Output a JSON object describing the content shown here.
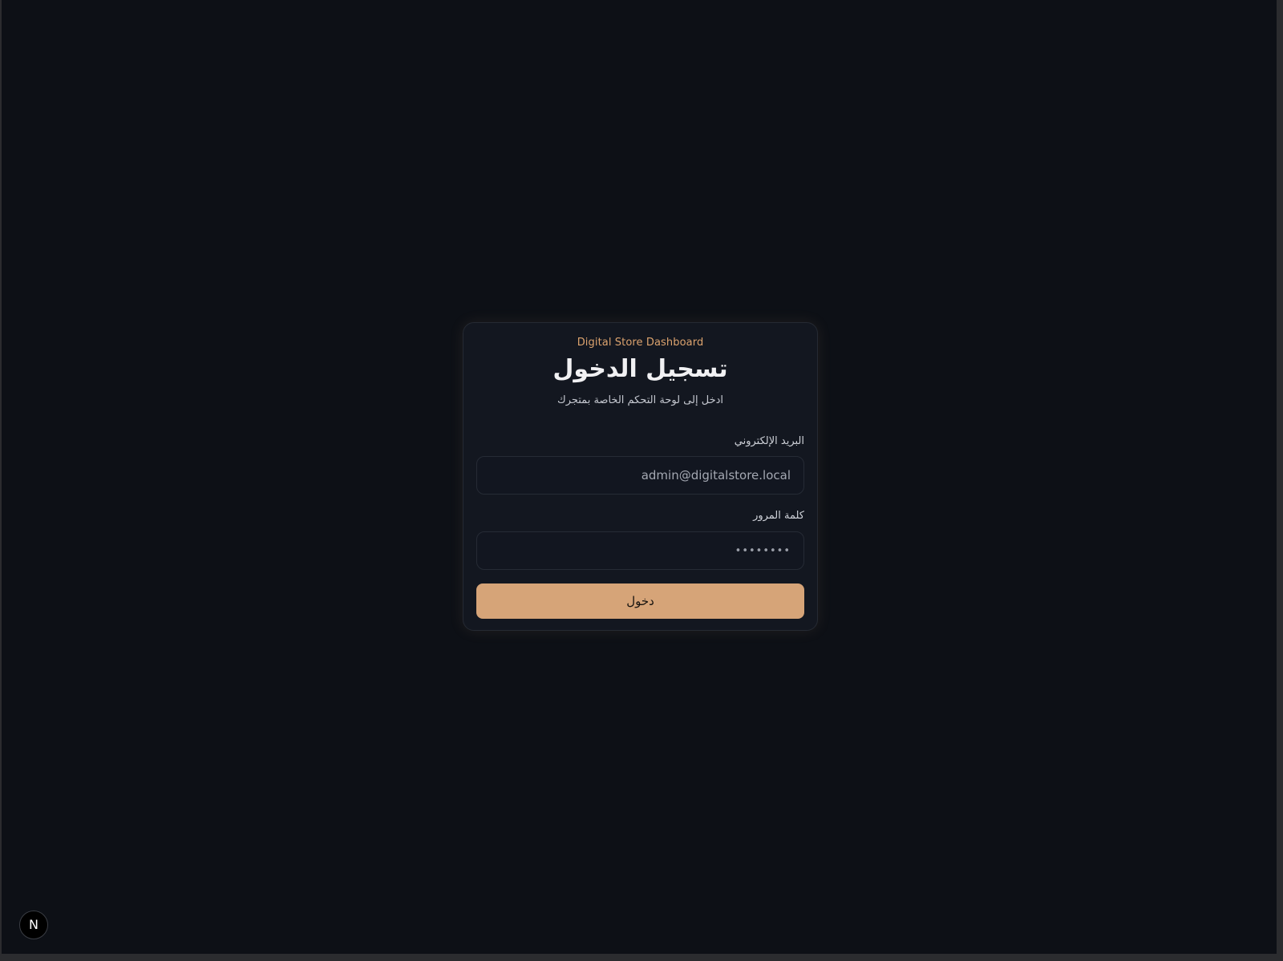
{
  "brand": "Digital Store Dashboard",
  "title": "تسجيل الدخول",
  "subtitle": "ادخل إلى لوحة التحكم الخاصة بمتجرك",
  "email": {
    "label": "البريد الإلكتروني",
    "value": "admin@digitalstore.local"
  },
  "password": {
    "label": "كلمة المرور",
    "value": "••••••••"
  },
  "submit_label": "دخول",
  "dev_badge": "N",
  "colors": {
    "background": "#0d1016",
    "card": "#131720",
    "accent": "#d6a478",
    "brand_text": "#dca36e"
  }
}
